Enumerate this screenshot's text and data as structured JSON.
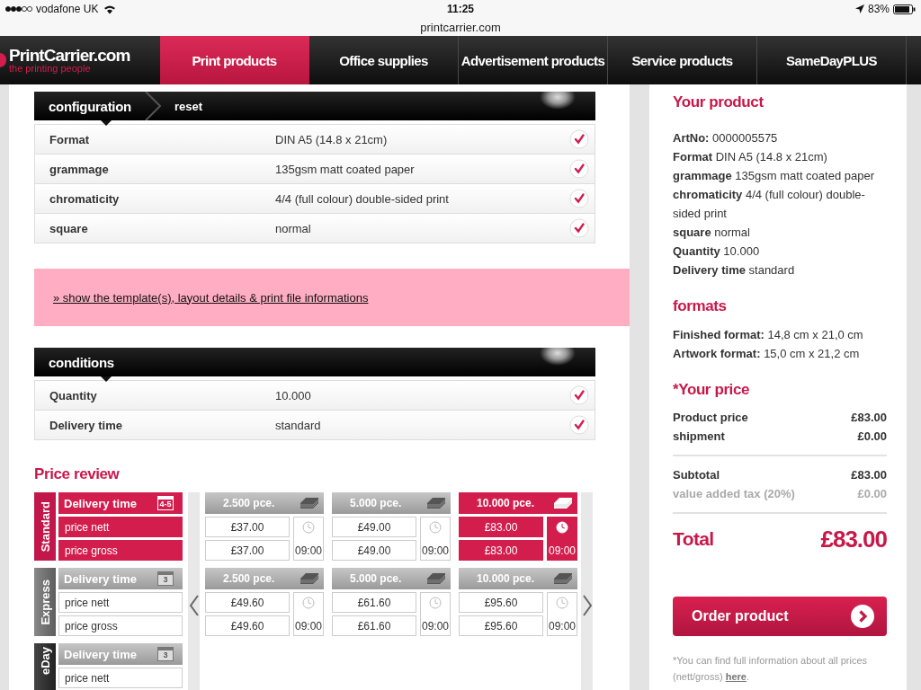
{
  "status_bar": {
    "carrier": "vodafone UK",
    "time": "11:25",
    "battery": "83%"
  },
  "address_bar": {
    "url": "printcarrier.com"
  },
  "logo": {
    "name": "PrintCarrier.com",
    "tagline": "the printing people"
  },
  "nav": [
    {
      "label": "Print products",
      "selected": true
    },
    {
      "label": "Office supplies",
      "selected": false
    },
    {
      "label": "Advertisement products",
      "selected": false
    },
    {
      "label": "Service products",
      "selected": false
    },
    {
      "label": "SameDayPLUS",
      "selected": false
    }
  ],
  "configuration": {
    "title": "configuration",
    "reset": "reset",
    "rows": [
      {
        "label": "Format",
        "value": "DIN A5 (14.8 x 21cm)",
        "checked": true
      },
      {
        "label": "grammage",
        "value": "135gsm matt coated paper",
        "checked": true
      },
      {
        "label": "chromaticity",
        "value": "4/4 (full colour) double-sided print",
        "checked": true
      },
      {
        "label": "square",
        "value": "normal",
        "checked": true
      }
    ]
  },
  "template_link": "» show the template(s), layout details & print file informations",
  "conditions": {
    "title": "conditions",
    "rows": [
      {
        "label": "Quantity",
        "value": "10.000",
        "checked": true
      },
      {
        "label": "Delivery time",
        "value": "standard",
        "checked": true
      }
    ]
  },
  "price_review": {
    "title": "Price review",
    "groups": [
      {
        "label": "Standard",
        "selected": true,
        "delivery_label": "Delivery time",
        "days": "4-5",
        "rows": [
          "price nett",
          "price gross"
        ],
        "quantities": [
          {
            "label": "2.500 pce.",
            "selected": false,
            "nett": "£37.00",
            "gross": "£37.00",
            "time": "09:00"
          },
          {
            "label": "5.000 pce.",
            "selected": false,
            "nett": "£49.00",
            "gross": "£49.00",
            "time": "09:00"
          },
          {
            "label": "10.000 pce.",
            "selected": true,
            "nett": "£83.00",
            "gross": "£83.00",
            "time": "09:00"
          }
        ]
      },
      {
        "label": "Express",
        "selected": false,
        "delivery_label": "Delivery time",
        "days": "3",
        "rows": [
          "price nett",
          "price gross"
        ],
        "quantities": [
          {
            "label": "2.500 pce.",
            "selected": false,
            "nett": "£49.60",
            "gross": "£49.60",
            "time": "09:00"
          },
          {
            "label": "5.000 pce.",
            "selected": false,
            "nett": "£61.60",
            "gross": "£61.60",
            "time": "09:00"
          },
          {
            "label": "10.000 pce.",
            "selected": false,
            "nett": "£95.60",
            "gross": "£95.60",
            "time": "09:00"
          }
        ]
      },
      {
        "label": "eDay",
        "selected": false,
        "delivery_label": "Delivery time",
        "days": "3",
        "rows": [
          "price nett"
        ]
      }
    ]
  },
  "sidebar": {
    "product_title": "Your product",
    "product_lines": [
      "**ArtNo:** 0000005575",
      "**Format** DIN A5 (14.8 x 21cm)",
      "**grammage** 135gsm matt coated paper",
      "**chromaticity** 4/4 (full colour) double-sided print",
      "**square** normal",
      "**Quantity** 10.000",
      "**Delivery time** standard"
    ],
    "formats_title": "formats",
    "format_lines": [
      "**Finished format:** 14,8 cm x 21,0 cm",
      "**Artwork format:** 15,0 cm x 21,2 cm"
    ],
    "price_title": "*Your price",
    "price_sections": [
      {
        "lines": [
          {
            "label": "Product price",
            "value": "£83.00",
            "muted": false
          },
          {
            "label": "shipment",
            "value": "£0.00",
            "muted": false
          }
        ]
      },
      {
        "lines": [
          {
            "label": "Subtotal",
            "value": "£83.00",
            "muted": false
          },
          {
            "label": "value added tax (20%)",
            "value": "£0.00",
            "muted": true
          }
        ]
      }
    ],
    "total": {
      "label": "Total",
      "value": "£83.00"
    },
    "order_button": "Order product",
    "note": {
      "before": "*You can find full information about all prices (nett/gross) ",
      "link": "here",
      "after": "."
    }
  }
}
